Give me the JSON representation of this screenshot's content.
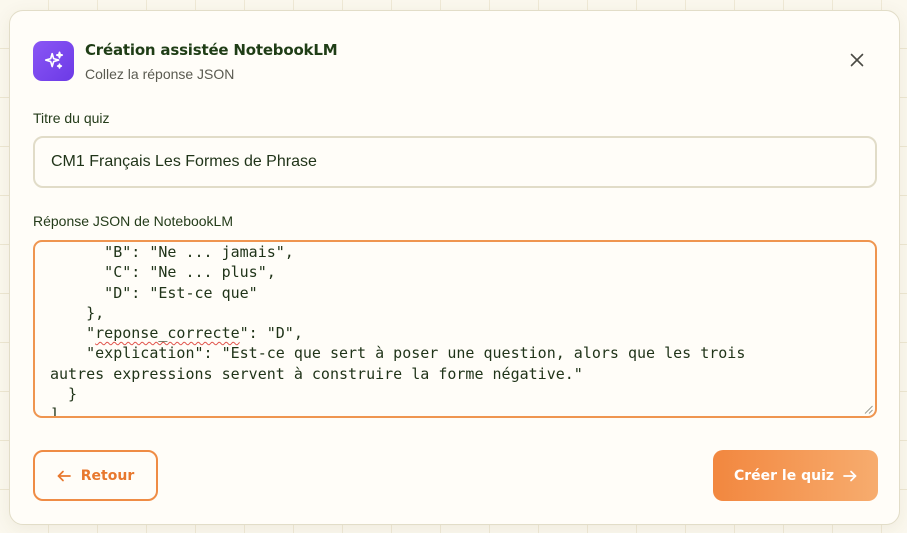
{
  "dialog": {
    "title": "Création assistée NotebookLM",
    "subtitle": "Collez la réponse JSON",
    "header_icon": "sparkles-icon",
    "close_icon": "close-icon"
  },
  "form": {
    "quiz_title_label": "Titre du quiz",
    "quiz_title_value": "CM1 Français Les Formes de Phrase",
    "json_label": "Réponse JSON de NotebookLM",
    "json_lines": [
      "      \"B\": \"Ne ... jamais\",",
      "      \"C\": \"Ne ... plus\",",
      "      \"D\": \"Est-ce que\"",
      "    },",
      "    \"reponse_correcte\": \"D\",",
      "    \"explication\": \"Est-ce que sert à poser une question, alors que les trois",
      "autres expressions servent à construire la forme négative.\"",
      "  }",
      "]"
    ],
    "json_flagged_word": "reponse_correcte"
  },
  "actions": {
    "back_label": "Retour",
    "create_label": "Créer le quiz",
    "back_icon": "arrow-left-icon",
    "create_icon": "arrow-right-icon"
  },
  "colors": {
    "accent_orange": "#ef8c45",
    "icon_purple": "#7c4aee",
    "title_green": "#1f3d16",
    "spellcheck_red": "#e0524a"
  }
}
